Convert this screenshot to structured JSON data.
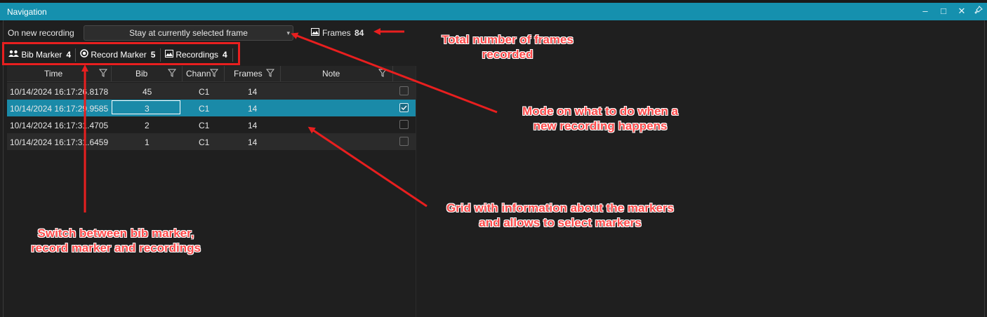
{
  "window": {
    "title": "Navigation"
  },
  "toolbar": {
    "recording_label": "On new recording",
    "recording_mode": "Stay at currently selected frame",
    "frames_label": "Frames",
    "frames_count": "84"
  },
  "tabs": [
    {
      "label": "Bib Marker",
      "count": "4",
      "icon": "people-icon"
    },
    {
      "label": "Record Marker",
      "count": "5",
      "icon": "record-icon"
    },
    {
      "label": "Recordings",
      "count": "4",
      "icon": "image-icon"
    }
  ],
  "grid": {
    "columns": [
      "Time",
      "Bib",
      "Chann",
      "Frames",
      "Note"
    ],
    "rows": [
      {
        "time": "10/14/2024 16:17:26.8178",
        "bib": "45",
        "channel": "C1",
        "frames": "14",
        "note": "",
        "checked": false
      },
      {
        "time": "10/14/2024 16:17:29.9585",
        "bib": "3",
        "channel": "C1",
        "frames": "14",
        "note": "",
        "checked": true
      },
      {
        "time": "10/14/2024 16:17:31.4705",
        "bib": "2",
        "channel": "C1",
        "frames": "14",
        "note": "",
        "checked": false
      },
      {
        "time": "10/14/2024 16:17:31.6459",
        "bib": "1",
        "channel": "C1",
        "frames": "14",
        "note": "",
        "checked": false
      }
    ]
  },
  "annotations": {
    "frames_total": [
      "Total number of frames",
      "recorded"
    ],
    "mode": [
      "Mode on what to do when a",
      "new recording happens"
    ],
    "grid_info": [
      "Grid with information about the markers",
      "and allows to select markers"
    ],
    "switch": [
      "Switch between bib marker,",
      "record marker and recordings"
    ]
  },
  "colors": {
    "accent": "#1590ae",
    "selected_row": "#1a8aa8",
    "annotation": "#e81f1f"
  }
}
